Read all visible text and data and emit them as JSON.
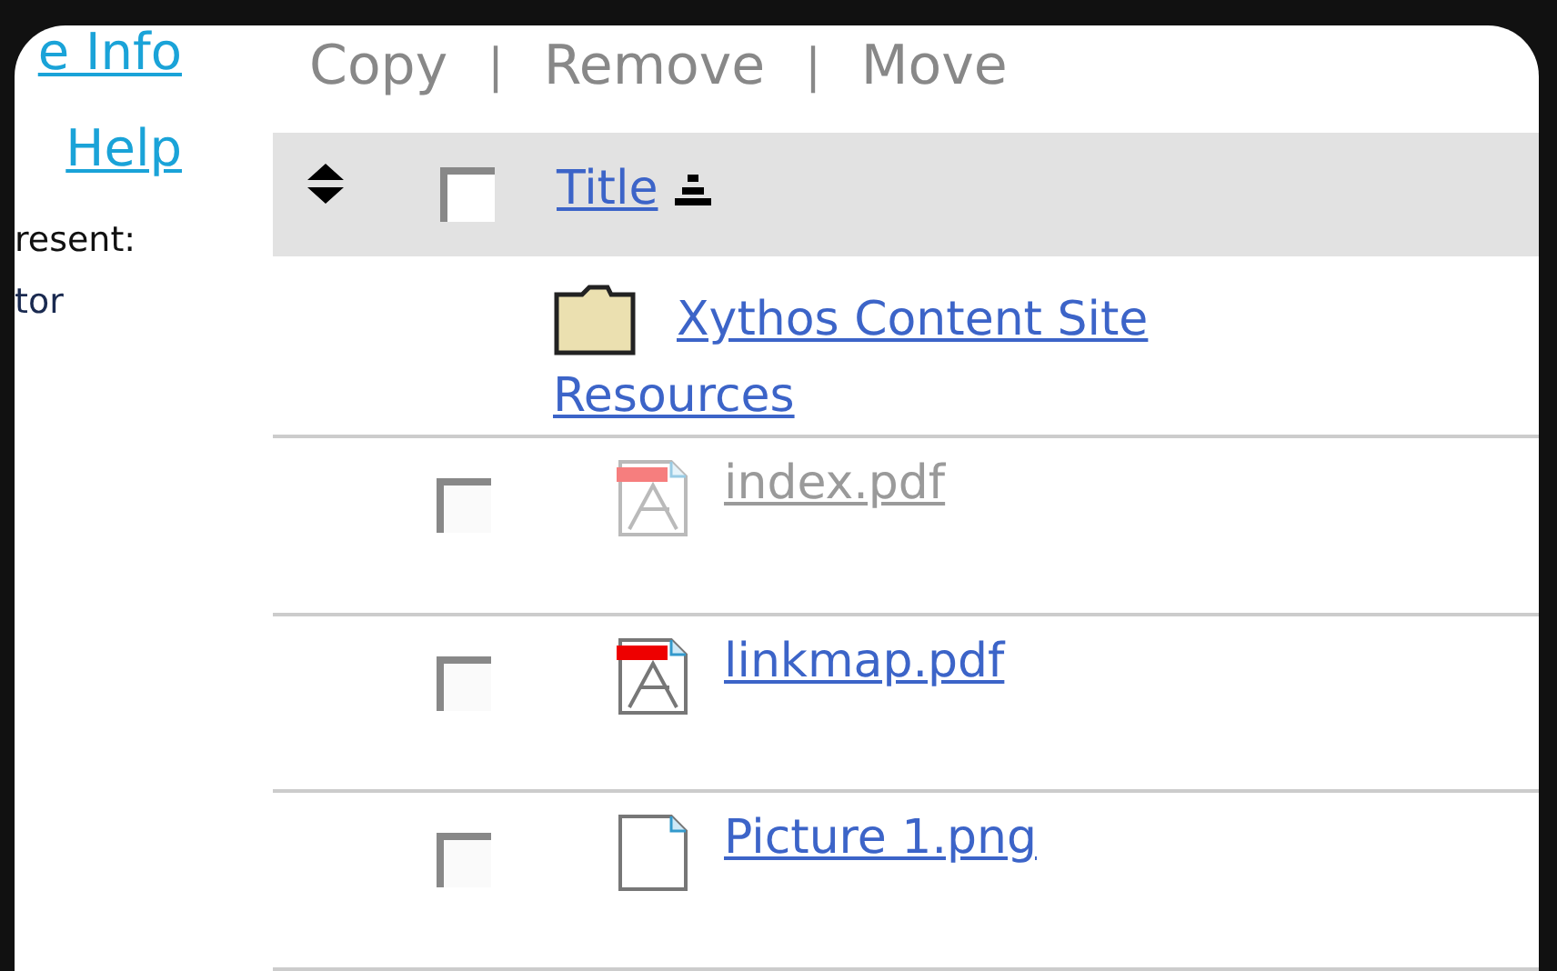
{
  "sidebar": {
    "links": [
      "e Info",
      "Help"
    ],
    "texts": [
      "resent:",
      "tor"
    ]
  },
  "toolbar": [
    {
      "kind": "action",
      "text": "Copy"
    },
    {
      "kind": "separator",
      "text": "|"
    },
    {
      "kind": "action",
      "text": "Remove"
    },
    {
      "kind": "separator",
      "text": "|"
    },
    {
      "kind": "action",
      "text": "Move"
    }
  ],
  "table": {
    "header": {
      "checked": false,
      "title": "Title"
    },
    "rows": [
      {
        "kind": "folder",
        "name": "Xythos Content Site Resources",
        "disabled": false
      },
      {
        "kind": "pdf",
        "name": "index.pdf",
        "checked": false,
        "disabled": true
      },
      {
        "kind": "pdf",
        "name": "linkmap.pdf",
        "checked": false,
        "disabled": false
      },
      {
        "kind": "file",
        "name": "Picture 1.png",
        "checked": false,
        "disabled": false
      }
    ]
  }
}
